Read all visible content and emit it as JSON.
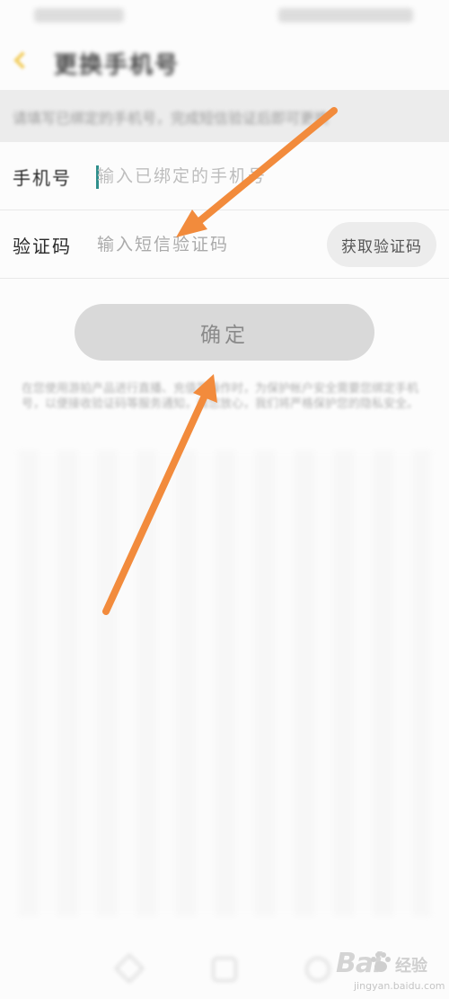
{
  "header": {
    "title": "更换手机号",
    "back_icon": "chevron-left-icon"
  },
  "notice": {
    "text": "请填写已绑定的手机号，完成短信验证后即可更换"
  },
  "form": {
    "phone": {
      "label": "手机号",
      "placeholder": "输入已绑定的手机号"
    },
    "code": {
      "label": "验证码",
      "placeholder": "输入短信验证码",
      "get_code_label": "获取验证码"
    },
    "confirm_label": "确定"
  },
  "disclaimer": "在您使用游拍产品进行直播、充值等操作时，为保护帐户安全需要您绑定手机号，以便接收验证码等服务通知，请您放心，我们将严格保护您的隐私安全。",
  "watermark": {
    "logo": "Bai",
    "logo_suffix": "经验",
    "sub": "jingyan.baidu.com"
  },
  "nav": {
    "back_icon": "nav-back-icon",
    "home_icon": "nav-home-icon",
    "recent_icon": "nav-recent-icon"
  },
  "colors": {
    "accent_arrow": "#f28b3c",
    "back_chevron": "#f3cf64",
    "cursor": "#2f8f8c",
    "button_bg": "#d9d9d9"
  }
}
